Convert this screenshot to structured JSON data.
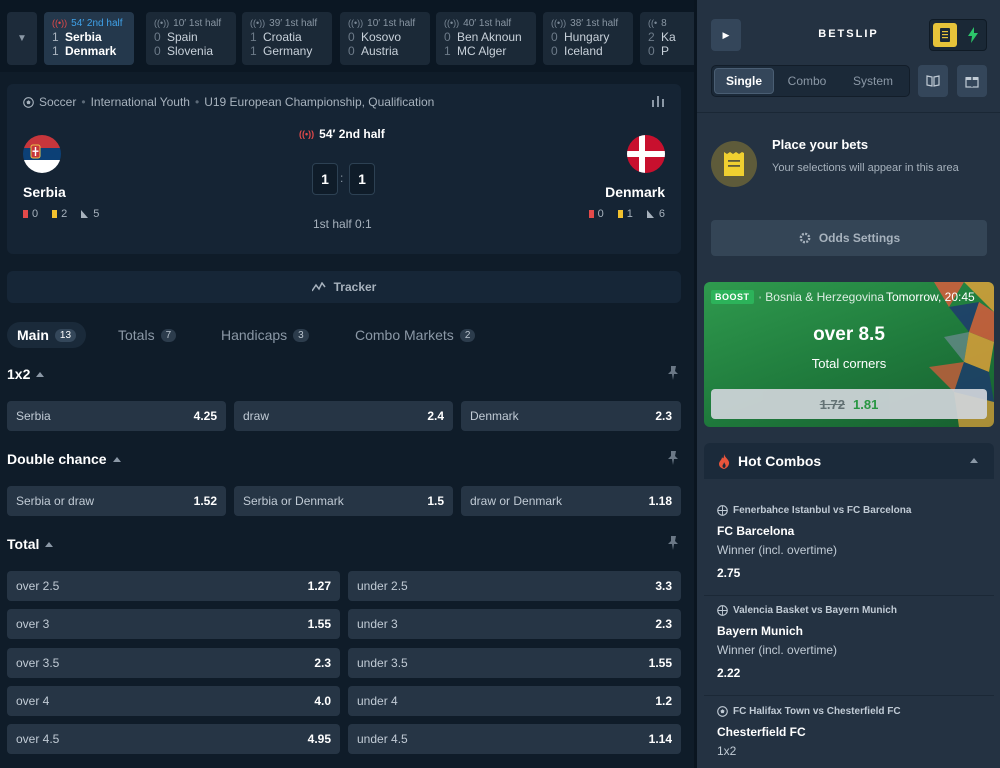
{
  "live_strip": {
    "cards": [
      {
        "time": "54′ 2nd half",
        "team1": "Serbia",
        "score1": "1",
        "team2": "Denmark",
        "score2": "1",
        "active": true
      },
      {
        "time": "10′ 1st half",
        "team1": "Spain",
        "score1": "0",
        "team2": "Slovenia",
        "score2": "0"
      },
      {
        "time": "39′ 1st half",
        "team1": "Croatia",
        "score1": "1",
        "team2": "Germany",
        "score2": "1"
      },
      {
        "time": "10′ 1st half",
        "team1": "Kosovo",
        "score1": "0",
        "team2": "Austria",
        "score2": "0"
      },
      {
        "time": "40′ 1st half",
        "team1": "Ben Aknoun",
        "score1": "0",
        "team2": "MC Alger",
        "score2": "1"
      },
      {
        "time": "38′ 1st half",
        "team1": "Hungary",
        "score1": "0",
        "team2": "Iceland",
        "score2": "0"
      },
      {
        "time": "8",
        "team1": "Ka",
        "score1": "2",
        "team2": "P",
        "score2": "0"
      }
    ]
  },
  "match": {
    "breadcrumb": [
      "Soccer",
      "International Youth",
      "U19 European Championship, Qualification"
    ],
    "time": "54′ 2nd half",
    "home": {
      "name": "Serbia",
      "score": "1",
      "red": "0",
      "yellow": "2",
      "corners": "5"
    },
    "away": {
      "name": "Denmark",
      "score": "1",
      "red": "0",
      "yellow": "1",
      "corners": "6"
    },
    "score_sep": ":",
    "half_score": "1st half 0:1",
    "tracker_label": "Tracker"
  },
  "market_tabs": [
    {
      "label": "Main",
      "count": "13",
      "active": true
    },
    {
      "label": "Totals",
      "count": "7"
    },
    {
      "label": "Handicaps",
      "count": "3"
    },
    {
      "label": "Combo Markets",
      "count": "2"
    }
  ],
  "markets": {
    "x12": {
      "title": "1x2",
      "odds": [
        {
          "label": "Serbia",
          "value": "4.25"
        },
        {
          "label": "draw",
          "value": "2.4"
        },
        {
          "label": "Denmark",
          "value": "2.3"
        }
      ]
    },
    "double_chance": {
      "title": "Double chance",
      "odds": [
        {
          "label": "Serbia or draw",
          "value": "1.52"
        },
        {
          "label": "Serbia or Denmark",
          "value": "1.5"
        },
        {
          "label": "draw or Denmark",
          "value": "1.18"
        }
      ]
    },
    "total": {
      "title": "Total",
      "rows": [
        [
          {
            "label": "over 2.5",
            "value": "1.27"
          },
          {
            "label": "under 2.5",
            "value": "3.3"
          }
        ],
        [
          {
            "label": "over 3",
            "value": "1.55"
          },
          {
            "label": "under 3",
            "value": "2.3"
          }
        ],
        [
          {
            "label": "over 3.5",
            "value": "2.3"
          },
          {
            "label": "under 3.5",
            "value": "1.55"
          }
        ],
        [
          {
            "label": "over 4",
            "value": "4.0"
          },
          {
            "label": "under 4",
            "value": "1.2"
          }
        ],
        [
          {
            "label": "over 4.5",
            "value": "4.95"
          },
          {
            "label": "under 4.5",
            "value": "1.14"
          }
        ]
      ]
    }
  },
  "betslip": {
    "title": "BETSLIP",
    "types": [
      "Single",
      "Combo",
      "System"
    ],
    "active_type": "Single",
    "empty_title": "Place your bets",
    "empty_sub": "Your selections will appear in this area",
    "odds_settings": "Odds Settings"
  },
  "boost": {
    "badge": "BOOST",
    "league": "Bosnia & Herzegovina",
    "date": "Tomorrow, 20:45",
    "main": "over 8.5",
    "sub": "Total corners",
    "old_odds": "1.72",
    "new_odds": "1.81"
  },
  "hot_combos": {
    "title": "Hot Combos",
    "items": [
      {
        "teams": "Fenerbahce Istanbul vs FC Barcelona",
        "pick": "FC Barcelona",
        "market": "Winner (incl. overtime)",
        "odds": "2.75",
        "sport": "basketball"
      },
      {
        "teams": "Valencia Basket vs Bayern Munich",
        "pick": "Bayern Munich",
        "market": "Winner (incl. overtime)",
        "odds": "2.22",
        "sport": "basketball"
      },
      {
        "teams": "FC Halifax Town vs Chesterfield FC",
        "pick": "Chesterfield FC",
        "market": "1x2",
        "odds": "",
        "sport": "soccer"
      }
    ]
  },
  "colors": {
    "accent_blue": "#3fa1e8",
    "live_red": "#e34a4a",
    "boost_green": "#2cb35a",
    "betslip_yellow": "#e6c33a",
    "new_odds_green": "#2a9a43"
  }
}
